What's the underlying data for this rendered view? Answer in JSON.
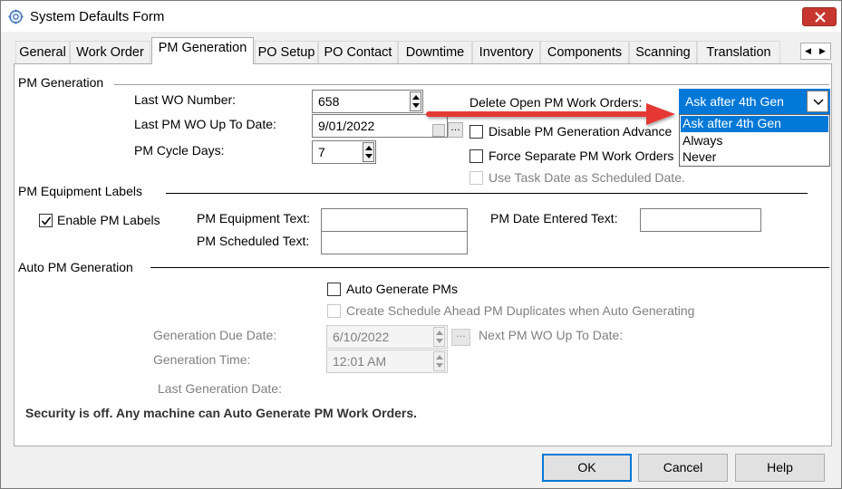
{
  "window": {
    "title": "System Defaults Form",
    "icon": "gear-icon",
    "close_icon": "close-icon"
  },
  "tabs": [
    {
      "label": "General",
      "active": false
    },
    {
      "label": "Work Order",
      "active": false
    },
    {
      "label": "PM Generation",
      "active": true
    },
    {
      "label": "PO Setup",
      "active": false
    },
    {
      "label": "PO Contact",
      "active": false
    },
    {
      "label": "Downtime",
      "active": false
    },
    {
      "label": "Inventory",
      "active": false
    },
    {
      "label": "Components",
      "active": false
    },
    {
      "label": "Scanning",
      "active": false
    },
    {
      "label": "Translation",
      "active": false
    }
  ],
  "pm_generation": {
    "section_title": "PM Generation",
    "last_wo_number_label": "Last WO Number:",
    "last_wo_number_value": "658",
    "last_pm_wo_date_label": "Last PM WO Up To Date:",
    "last_pm_wo_date_value": "9/01/2022",
    "pm_cycle_days_label": "PM Cycle Days:",
    "pm_cycle_days_value": "7",
    "delete_open_label": "Delete Open PM Work Orders:",
    "delete_open_selected": "Ask after 4th Gen",
    "delete_open_options": [
      "Ask after 4th Gen",
      "Always",
      "Never"
    ],
    "disable_pm_label": "Disable PM Generation  Advance",
    "force_separate_label": "Force Separate PM Work Orders",
    "use_task_date_label": "Use Task Date as Scheduled Date."
  },
  "pm_equipment_labels": {
    "section_title": "PM Equipment Labels",
    "enable_label": "Enable PM Labels",
    "enable_checked": true,
    "equipment_text_label": "PM Equipment Text:",
    "scheduled_text_label": "PM Scheduled Text:",
    "date_entered_text_label": "PM Date Entered Text:",
    "equipment_text_value": "",
    "scheduled_text_value": "",
    "date_entered_text_value": ""
  },
  "auto_pm": {
    "section_title": "Auto PM Generation",
    "auto_generate_label": "Auto Generate PMs",
    "create_schedule_label": "Create Schedule Ahead PM Duplicates when Auto Generating",
    "generation_due_date_label": "Generation Due Date:",
    "generation_due_date_value": "6/10/2022",
    "next_pm_wo_label": "Next PM WO Up To Date:",
    "generation_time_label": "Generation Time:",
    "generation_time_value": "12:01 AM",
    "last_generation_date_label": "Last Generation Date:",
    "security_message": "Security is off. Any machine can Auto Generate PM Work Orders."
  },
  "buttons": {
    "ok": "OK",
    "cancel": "Cancel",
    "help": "Help"
  },
  "colors": {
    "accent": "#0078d7",
    "close_button": "#c7372f",
    "annotation_arrow": "#e53935"
  }
}
